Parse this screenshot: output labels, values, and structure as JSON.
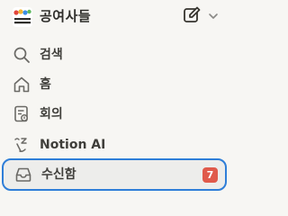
{
  "workspace": {
    "name": "공여사들",
    "logo_text": "공여사들"
  },
  "nav": {
    "search_label": "검색",
    "home_label": "홈",
    "meeting_label": "회의",
    "ai_label": "Notion AI",
    "inbox_label": "수신함",
    "inbox_badge": "7"
  },
  "colors": {
    "sidebar_bg": "#f7f6f3",
    "selected_bg": "#ededeb",
    "focus_ring": "#2f7ed8",
    "badge_bg": "#e05a4b"
  }
}
